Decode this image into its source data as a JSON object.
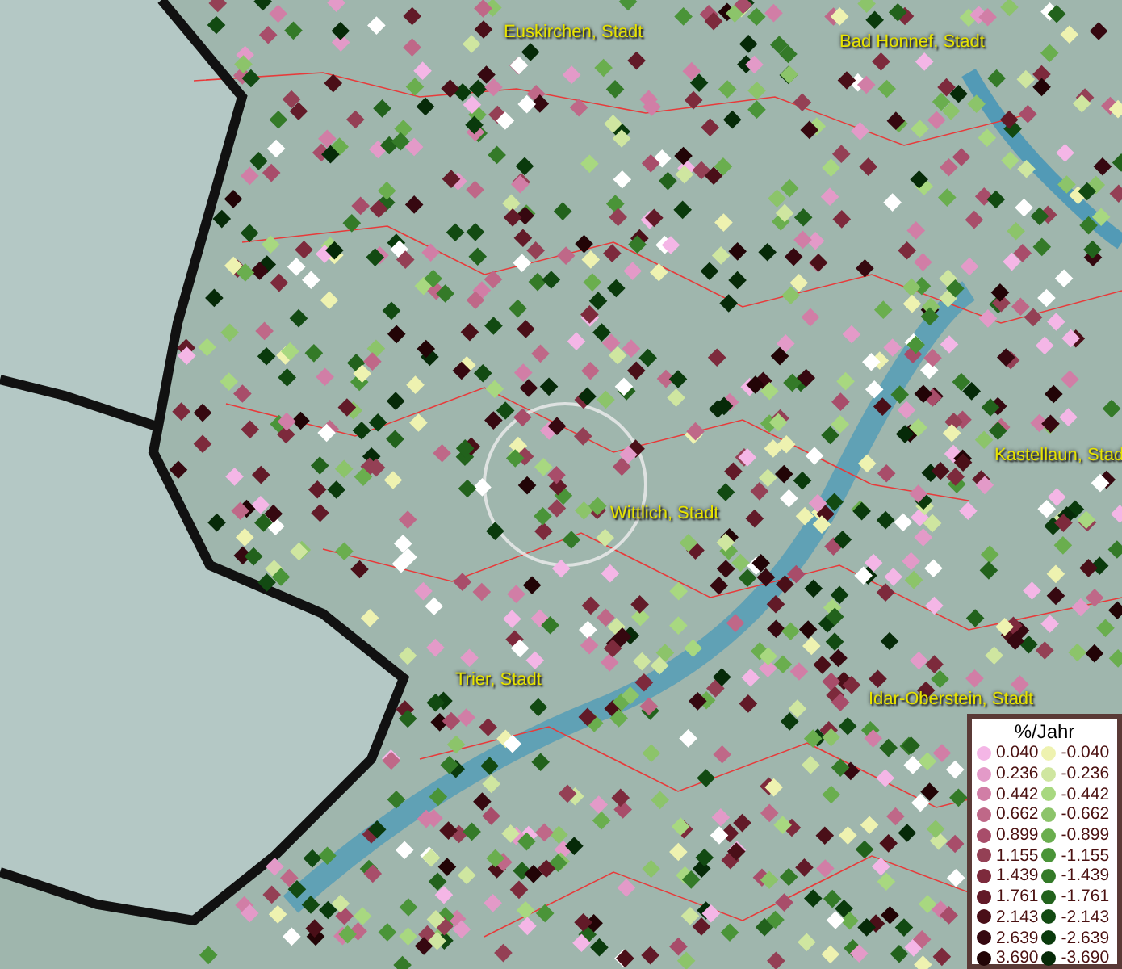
{
  "map": {
    "places": [
      {
        "name": "Euskirchen, Stadt"
      },
      {
        "name": "Bad Honnef, Stadt"
      },
      {
        "name": "Kastellaun, Stad"
      },
      {
        "name": "Wittlich, Stadt"
      },
      {
        "name": "Trier, Stadt"
      },
      {
        "name": "Idar-Oberstein, Stadt"
      }
    ]
  },
  "legend": {
    "title": "%/Jahr",
    "positive": [
      {
        "label": "0.040",
        "color": "#f4b6e6"
      },
      {
        "label": "0.236",
        "color": "#e39ac8"
      },
      {
        "label": "0.442",
        "color": "#d17ea6"
      },
      {
        "label": "0.662",
        "color": "#bf6888"
      },
      {
        "label": "0.899",
        "color": "#a84d6a"
      },
      {
        "label": "1.155",
        "color": "#944055"
      },
      {
        "label": "1.439",
        "color": "#7d2a3c"
      },
      {
        "label": "1.761",
        "color": "#621a28"
      },
      {
        "label": "2.143",
        "color": "#4a0f18"
      },
      {
        "label": "2.639",
        "color": "#360810"
      },
      {
        "label": "3.690",
        "color": "#220406"
      }
    ],
    "negative": [
      {
        "label": "-0.040",
        "color": "#eef2b0"
      },
      {
        "label": "-0.236",
        "color": "#cfe6a0"
      },
      {
        "label": "-0.442",
        "color": "#a8d880"
      },
      {
        "label": "-0.662",
        "color": "#8cc46a"
      },
      {
        "label": "-0.899",
        "color": "#6aae4e"
      },
      {
        "label": "-1.155",
        "color": "#4a9438"
      },
      {
        "label": "-1.439",
        "color": "#347a28"
      },
      {
        "label": "-1.761",
        "color": "#22621c"
      },
      {
        "label": "-2.143",
        "color": "#124a12"
      },
      {
        "label": "-2.639",
        "color": "#0a3a0c"
      },
      {
        "label": "-3.690",
        "color": "#062a08"
      }
    ]
  }
}
